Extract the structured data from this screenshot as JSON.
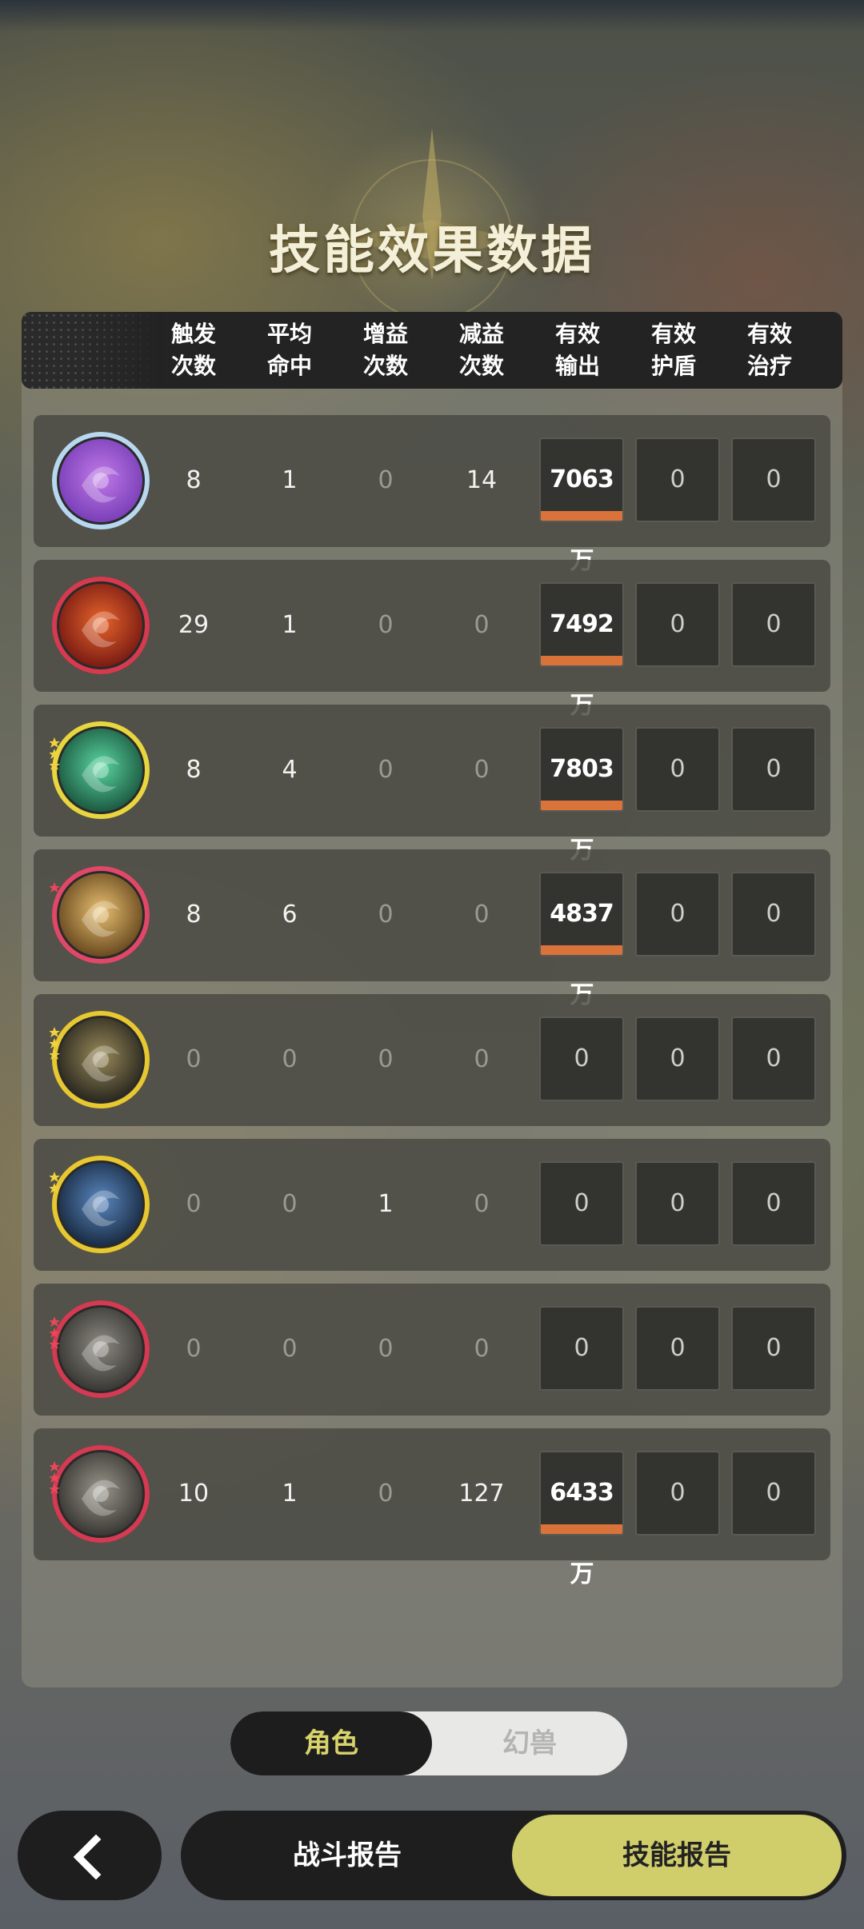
{
  "title": "技能效果数据",
  "columns": [
    {
      "line1": "触发",
      "line2": "次数"
    },
    {
      "line1": "平均",
      "line2": "命中"
    },
    {
      "line1": "增益",
      "line2": "次数"
    },
    {
      "line1": "减益",
      "line2": "次数"
    },
    {
      "line1": "有效",
      "line2": "输出"
    },
    {
      "line1": "有效",
      "line2": "护盾"
    },
    {
      "line1": "有效",
      "line2": "治疗"
    }
  ],
  "rows": [
    {
      "icon": "purple-heart-skill-icon",
      "trigger": "8",
      "hit": "1",
      "buff": "0",
      "debuff": "14",
      "output": "7063万",
      "shield": "0",
      "heal": "0"
    },
    {
      "icon": "fire-swirl-skill-icon",
      "trigger": "29",
      "hit": "1",
      "buff": "0",
      "debuff": "0",
      "output": "7492万",
      "shield": "0",
      "heal": "0"
    },
    {
      "icon": "jade-wind-skill-icon",
      "trigger": "8",
      "hit": "4",
      "buff": "0",
      "debuff": "0",
      "output": "7803万",
      "shield": "0",
      "heal": "0"
    },
    {
      "icon": "golden-slash-skill-icon",
      "trigger": "8",
      "hit": "6",
      "buff": "0",
      "debuff": "0",
      "output": "4837万",
      "shield": "0",
      "heal": "0"
    },
    {
      "icon": "eye-skill-icon",
      "trigger": "0",
      "hit": "0",
      "buff": "0",
      "debuff": "0",
      "output": "0",
      "shield": "0",
      "heal": "0"
    },
    {
      "icon": "blue-crest-skill-icon",
      "trigger": "0",
      "hit": "0",
      "buff": "1",
      "debuff": "0",
      "output": "0",
      "shield": "0",
      "heal": "0"
    },
    {
      "icon": "dancer-skill-icon",
      "trigger": "0",
      "hit": "0",
      "buff": "0",
      "debuff": "0",
      "output": "0",
      "shield": "0",
      "heal": "0"
    },
    {
      "icon": "leaf-skill-icon",
      "trigger": "10",
      "hit": "1",
      "buff": "0",
      "debuff": "127",
      "output": "6433万",
      "shield": "0",
      "heal": "0"
    }
  ],
  "toggle": {
    "active": "角色",
    "inactive": "幻兽"
  },
  "tabs": {
    "battle_report": "战斗报告",
    "skill_report": "技能报告"
  },
  "colors": {
    "accent_yellow": "#d0cd6b",
    "output_bar": "#d9733a",
    "panel_dark": "#232323"
  }
}
